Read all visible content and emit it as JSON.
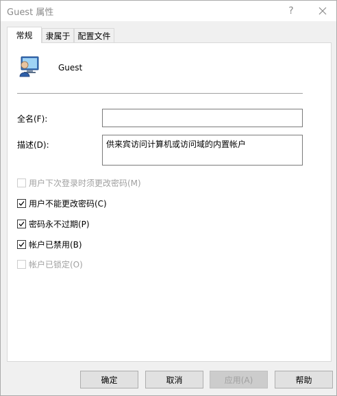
{
  "window": {
    "title": "Guest 属性"
  },
  "titlebar": {
    "help_glyph": "?",
    "close_icon": "close-icon"
  },
  "tabs": [
    {
      "label": "常规",
      "active": true
    },
    {
      "label": "隶属于",
      "active": false
    },
    {
      "label": "配置文件",
      "active": false
    }
  ],
  "general": {
    "user_icon": "user-icon",
    "username": "Guest",
    "fullname_label": "全名(F):",
    "fullname_value": "",
    "description_label": "描述(D):",
    "description_value": "供来宾访问计算机或访问域的内置帐户"
  },
  "checkboxes": [
    {
      "label": "用户下次登录时须更改密码(M)",
      "checked": false,
      "enabled": false
    },
    {
      "label": "用户不能更改密码(C)",
      "checked": true,
      "enabled": true
    },
    {
      "label": "密码永不过期(P)",
      "checked": true,
      "enabled": true
    },
    {
      "label": "帐户已禁用(B)",
      "checked": true,
      "enabled": true
    },
    {
      "label": "帐户已锁定(O)",
      "checked": false,
      "enabled": false
    }
  ],
  "buttons": {
    "ok": "确定",
    "cancel": "取消",
    "apply": "应用(A)",
    "help": "帮助"
  },
  "colors": {
    "disabled_text": "#a0a0a0",
    "dialog_background": "#f0f0f0"
  }
}
